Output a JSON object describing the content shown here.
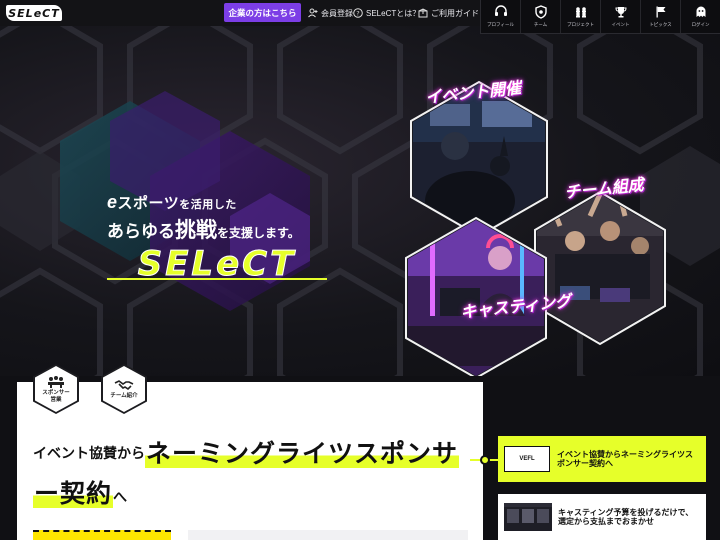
{
  "header": {
    "logo_text": "SELeCT",
    "corp_button": "企業の方はこちら",
    "links": [
      {
        "label": "会員登録",
        "icon": "user-plus-icon"
      },
      {
        "label": "SELeCTとは？",
        "icon": "help-circle-icon"
      },
      {
        "label": "ご利用ガイド",
        "icon": "box-icon"
      }
    ],
    "nav": [
      {
        "label": "プロフィール",
        "icon": "headset-icon"
      },
      {
        "label": "チーム",
        "icon": "shield-icon"
      },
      {
        "label": "プロジェクト",
        "icon": "people-icon"
      },
      {
        "label": "イベント",
        "icon": "trophy-icon"
      },
      {
        "label": "トピックス",
        "icon": "flag-icon"
      },
      {
        "label": "ログイン",
        "icon": "ghost-icon"
      }
    ]
  },
  "hero": {
    "tagline_line1_e": "e",
    "tagline_line1_a": "スポーツ",
    "tagline_line1_b": "を活用した",
    "tagline_line2_a": "あらゆる",
    "tagline_line2_b": "挑戦",
    "tagline_line2_c": "を支援します。",
    "logo_text": "SELeCT",
    "hex_labels": {
      "event": "イベント開催",
      "team": "チーム組成",
      "casting": "キャスティング"
    }
  },
  "categories": [
    {
      "label": "スポンサー\n営業",
      "icon": "meeting-icon"
    },
    {
      "label": "チーム紹介",
      "icon": "handshake-icon"
    }
  ],
  "article": {
    "headline_pre": "イベント協賛から",
    "headline_hl1": "ネーミングライツスポンサ",
    "headline_hl2": "ー契約",
    "headline_post": "へ"
  },
  "news": [
    {
      "title": "イベント協賛からネーミングライツスポンサー契約へ",
      "thumb_text": "VEFL"
    },
    {
      "title": "キャスティング予算を投げるだけで、選定から支払までおまかせ",
      "thumb_text": ""
    }
  ],
  "colors": {
    "accent_purple": "#7c3ee6",
    "accent_yellow": "#e6ff2a",
    "neon_pink": "#ff3cd6"
  }
}
